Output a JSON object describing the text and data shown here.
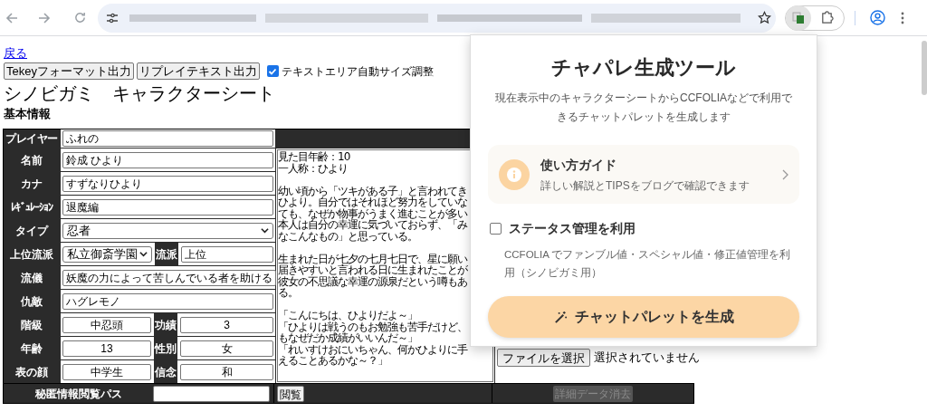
{
  "page": {
    "back_link": "戻る",
    "buttons": [
      "Tekeyフォーマット出力",
      "リプレイテキスト出力"
    ],
    "auto_resize": {
      "label": "テキストエリア自動サイズ調整",
      "checked": true
    },
    "title": "シノビガミ　キャラクターシート",
    "section": "基本情報"
  },
  "sheet": {
    "player": {
      "label": "プレイヤー",
      "value": "ふれの"
    },
    "rows": [
      {
        "kind": "text",
        "label": "名前",
        "value": "鈴成 ひより"
      },
      {
        "kind": "text",
        "label": "カナ",
        "value": "すずなりひより"
      },
      {
        "kind": "text",
        "label": "ﾚｷﾞｭﾚｰｼｮﾝ",
        "value": "退魔編"
      },
      {
        "kind": "select",
        "label": "タイプ",
        "value": "忍者"
      },
      {
        "kind": "select_pair",
        "label": "上位流派",
        "value": "私立御斎学園",
        "label2": "流派",
        "value2": "上位"
      },
      {
        "kind": "text",
        "label": "流儀",
        "value": "妖魔の力によって苦しんでいる者を助ける"
      },
      {
        "kind": "text",
        "label": "仇敵",
        "value": "ハグレモノ"
      },
      {
        "kind": "pair",
        "label": "階級",
        "value": "中忍頭",
        "label2": "功績",
        "value2": "3"
      },
      {
        "kind": "pair",
        "label": "年齢",
        "value": "13",
        "label2": "性別",
        "value2": "女"
      },
      {
        "kind": "pair",
        "label": "表の顔",
        "value": "中学生",
        "label2": "信念",
        "value2": "和"
      }
    ],
    "memo": [
      [
        "見た目年齢：10",
        "一人称：ひより"
      ],
      [
        "幼い頃から「ツキがある子」と言われてき",
        "ひより。自分ではそれほど努力をしていな",
        "ても、なぜか物事がうまく進むことが多い",
        "本人は自分の幸運に気づいておらず、「み",
        "なこんなもの」と思っている。"
      ],
      [
        "生まれた日が七夕の七月七日で、星に願い",
        "届きやすいと言われる日に生まれたことが",
        "彼女の不思議な幸運の源泉だという噂もあ",
        "る。"
      ],
      [
        "「こんにちは、ひよりだよ～」",
        "「ひよりは戦うのもお勉強も苦手だけど、",
        "もなぜだか成績がいいんだ～」",
        "「れいすけおにいちゃん、何かひよりに手",
        "えることあるかな～？」"
      ]
    ],
    "file_button": "ファイルを選択",
    "file_status": "選択されていません",
    "secret": {
      "label": "秘匿情報閲覧パス",
      "button": "閲覧"
    },
    "clear_button": {
      "label": "詳細データ消去",
      "disabled": true
    }
  },
  "popup": {
    "title": "チャパレ生成ツール",
    "description": "現在表示中のキャラクターシートからCCFOLIAなどで利用できるチャットパレットを生成します",
    "guide": {
      "title": "使い方ガイド",
      "subtitle": "詳しい解説とTIPSをブログで確認できます"
    },
    "status_option": {
      "label": "ステータス管理を利用",
      "checked": false,
      "note": "CCFOLIA でファンブル値・スペシャル値・修正値管理を利用（シノビガミ用）"
    },
    "generate_button": "チャットパレットを生成"
  }
}
